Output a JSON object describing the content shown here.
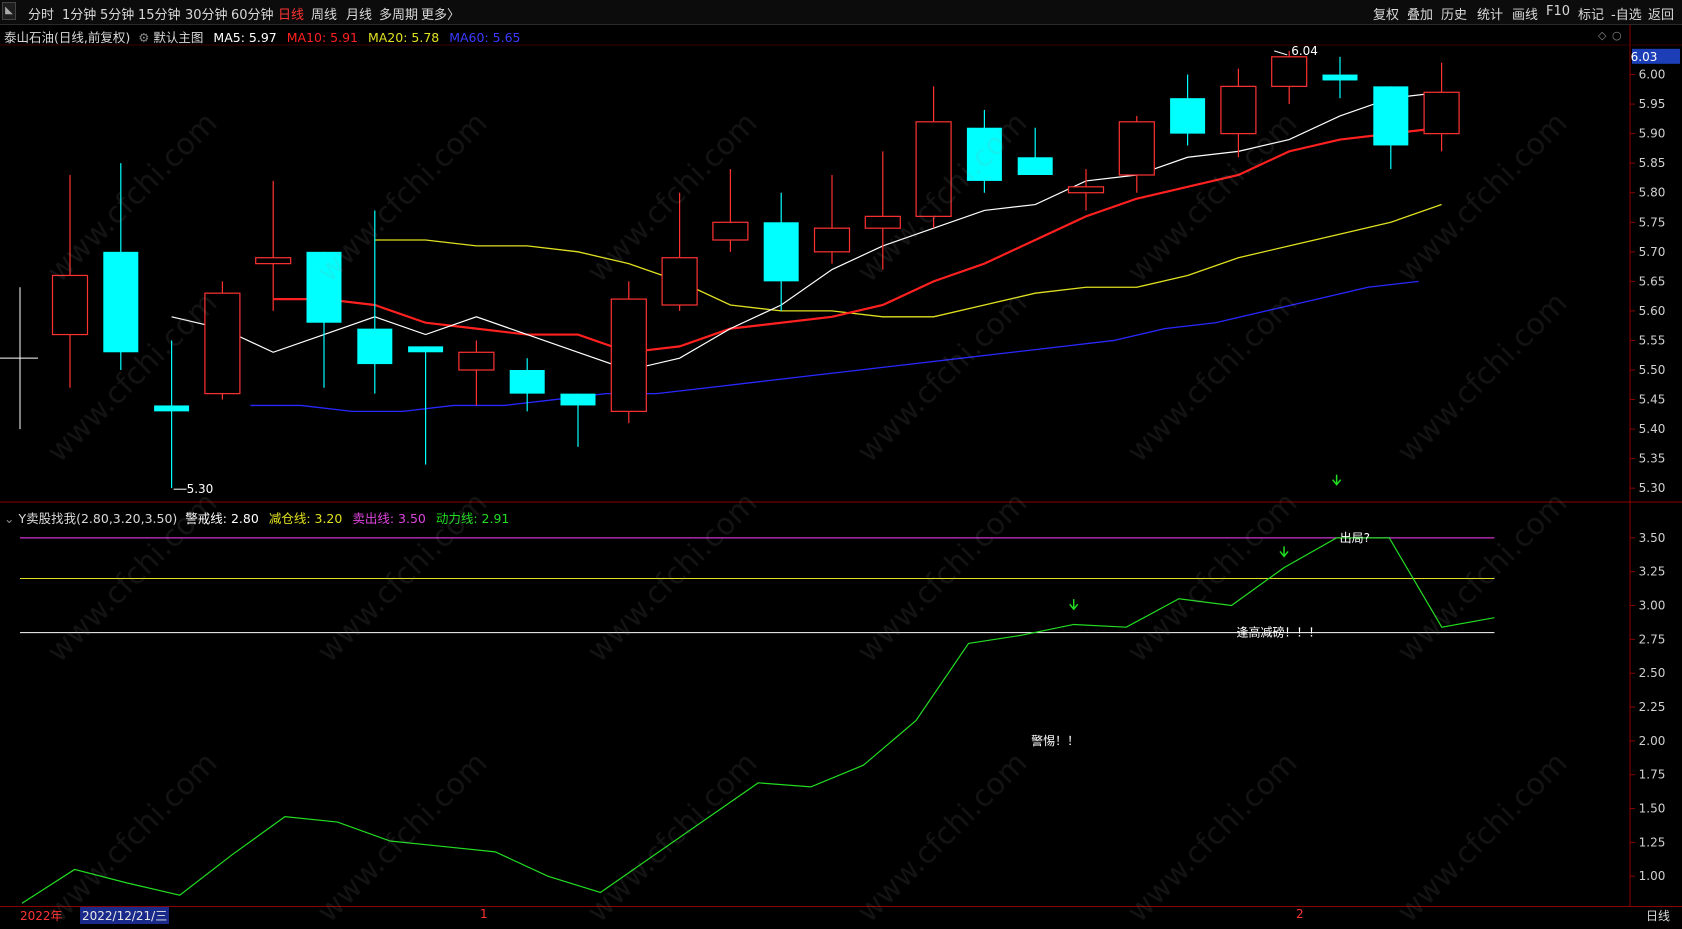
{
  "toolbar": {
    "left_items": [
      "分时",
      "1分钟",
      "5分钟",
      "15分钟",
      "30分钟",
      "60分钟",
      "日线",
      "周线",
      "月线",
      "多周期",
      "更多〉"
    ],
    "active": "日线",
    "right_items": [
      "复权",
      "叠加",
      "历史",
      "统计",
      "画线",
      "F10",
      "标记",
      "-自选",
      "返回"
    ]
  },
  "main_legend": {
    "stock": "泰山石油(日线,前复权)",
    "template": "默认主图",
    "ma5": "MA5: 5.97",
    "ma10": "MA10: 5.91",
    "ma20": "MA20: 5.78",
    "ma60": "MA60: 5.65",
    "price_tag": "6.03",
    "high_label": "6.04",
    "low_label": "5.30"
  },
  "indicator_legend": {
    "name": "Y卖股找我(2.80,3.20,3.50)",
    "warn": "警戒线: 2.80",
    "reduce": "减仓线: 3.20",
    "sell": "卖出线: 3.50",
    "power": "动力线: 2.91"
  },
  "annotations": {
    "exit": "出局?",
    "reduce_high": "逢高减磅！！！",
    "alert": "警惕！！"
  },
  "bottom": {
    "year": "2022年",
    "date": "2022/12/21/三",
    "mark1": "1",
    "mark2": "2",
    "period": "日线"
  },
  "watermark": "www.cfchi.com",
  "colors": {
    "up": "#ff3232",
    "down": "#00ffff",
    "ma5": "#ffffff",
    "ma10": "#ff2020",
    "ma20": "#e0e020",
    "ma60": "#2828ff",
    "sell": "#cc33cc",
    "reduce": "#e0e020",
    "warn": "#ffffff",
    "power": "#22dd22"
  },
  "chart_data": [
    {
      "type": "candlestick",
      "price_axis": [
        6.0,
        5.95,
        5.9,
        5.85,
        5.8,
        5.75,
        5.7,
        5.65,
        5.6,
        5.55,
        5.5,
        5.45,
        5.4,
        5.35,
        5.3
      ],
      "ylim": [
        5.28,
        6.05
      ],
      "candles": [
        {
          "o": 5.56,
          "h": 5.83,
          "l": 5.47,
          "c": 5.66
        },
        {
          "o": 5.7,
          "h": 5.85,
          "l": 5.5,
          "c": 5.53
        },
        {
          "o": 5.44,
          "h": 5.55,
          "l": 5.3,
          "c": 5.43
        },
        {
          "o": 5.46,
          "h": 5.65,
          "l": 5.45,
          "c": 5.63
        },
        {
          "o": 5.68,
          "h": 5.82,
          "l": 5.6,
          "c": 5.69
        },
        {
          "o": 5.7,
          "h": 5.7,
          "l": 5.47,
          "c": 5.58
        },
        {
          "o": 5.57,
          "h": 5.77,
          "l": 5.46,
          "c": 5.51
        },
        {
          "o": 5.54,
          "h": 5.54,
          "l": 5.34,
          "c": 5.53
        },
        {
          "o": 5.5,
          "h": 5.55,
          "l": 5.44,
          "c": 5.53
        },
        {
          "o": 5.5,
          "h": 5.52,
          "l": 5.43,
          "c": 5.46
        },
        {
          "o": 5.46,
          "h": 5.46,
          "l": 5.37,
          "c": 5.44
        },
        {
          "o": 5.43,
          "h": 5.65,
          "l": 5.41,
          "c": 5.62
        },
        {
          "o": 5.61,
          "h": 5.8,
          "l": 5.6,
          "c": 5.69
        },
        {
          "o": 5.72,
          "h": 5.84,
          "l": 5.7,
          "c": 5.75
        },
        {
          "o": 5.75,
          "h": 5.8,
          "l": 5.6,
          "c": 5.65
        },
        {
          "o": 5.7,
          "h": 5.83,
          "l": 5.68,
          "c": 5.74
        },
        {
          "o": 5.74,
          "h": 5.87,
          "l": 5.67,
          "c": 5.76
        },
        {
          "o": 5.76,
          "h": 5.98,
          "l": 5.74,
          "c": 5.92
        },
        {
          "o": 5.91,
          "h": 5.94,
          "l": 5.8,
          "c": 5.82
        },
        {
          "o": 5.86,
          "h": 5.91,
          "l": 5.83,
          "c": 5.83
        },
        {
          "o": 5.8,
          "h": 5.84,
          "l": 5.77,
          "c": 5.81
        },
        {
          "o": 5.83,
          "h": 5.93,
          "l": 5.8,
          "c": 5.92
        },
        {
          "o": 5.96,
          "h": 6.0,
          "l": 5.88,
          "c": 5.9
        },
        {
          "o": 5.9,
          "h": 6.01,
          "l": 5.86,
          "c": 5.98
        },
        {
          "o": 5.98,
          "h": 6.04,
          "l": 5.95,
          "c": 6.03
        },
        {
          "o": 6.0,
          "h": 6.03,
          "l": 5.96,
          "c": 5.99
        },
        {
          "o": 5.98,
          "h": 5.98,
          "l": 5.84,
          "c": 5.88
        },
        {
          "o": 5.9,
          "h": 6.02,
          "l": 5.87,
          "c": 5.97
        }
      ],
      "ma5": [
        5.59,
        5.57,
        5.53,
        5.56,
        5.59,
        5.56,
        5.59,
        5.56,
        5.53,
        5.5,
        5.52,
        5.57,
        5.61,
        5.67,
        5.71,
        5.74,
        5.77,
        5.78,
        5.82,
        5.83,
        5.86,
        5.87,
        5.89,
        5.93,
        5.96,
        5.97
      ],
      "ma10": [
        5.62,
        5.62,
        5.61,
        5.58,
        5.57,
        5.56,
        5.56,
        5.53,
        5.54,
        5.57,
        5.58,
        5.59,
        5.61,
        5.65,
        5.68,
        5.72,
        5.76,
        5.79,
        5.81,
        5.83,
        5.87,
        5.89,
        5.9,
        5.91
      ],
      "ma20": [
        5.72,
        5.72,
        5.71,
        5.71,
        5.7,
        5.68,
        5.65,
        5.61,
        5.6,
        5.6,
        5.59,
        5.59,
        5.61,
        5.63,
        5.64,
        5.64,
        5.66,
        5.69,
        5.71,
        5.73,
        5.75,
        5.78
      ],
      "ma60": [
        5.44,
        5.44,
        5.43,
        5.43,
        5.44,
        5.44,
        5.45,
        5.46,
        5.46,
        5.47,
        5.48,
        5.49,
        5.5,
        5.51,
        5.52,
        5.53,
        5.54,
        5.55,
        5.57,
        5.58,
        5.6,
        5.62,
        5.64,
        5.65
      ]
    },
    {
      "type": "line",
      "title": "Y卖股找我",
      "y_axis": [
        3.5,
        3.25,
        3.0,
        2.75,
        2.5,
        2.25,
        2.0,
        1.75,
        1.5,
        1.25,
        1.0
      ],
      "ylim": [
        0.78,
        3.75
      ],
      "levels": {
        "sell": 3.5,
        "reduce": 3.2,
        "warn": 2.8
      },
      "power": [
        0.8,
        1.05,
        0.95,
        0.86,
        1.16,
        1.44,
        1.4,
        1.26,
        1.22,
        1.18,
        1.0,
        0.88,
        1.15,
        1.42,
        1.69,
        1.66,
        1.82,
        2.15,
        2.72,
        2.78,
        2.86,
        2.84,
        3.05,
        3.0,
        3.28,
        3.5,
        3.5,
        2.84,
        2.91
      ],
      "arrows": [
        {
          "x": 20,
          "y": 2.98
        },
        {
          "x": 24,
          "y": 3.37
        },
        {
          "x": 25,
          "y": 3.9
        }
      ]
    }
  ]
}
